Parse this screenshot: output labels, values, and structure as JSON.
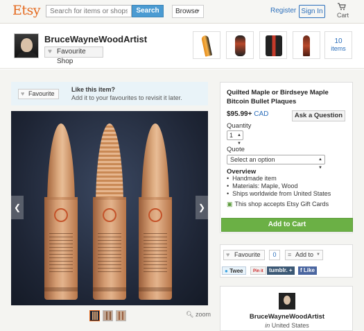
{
  "header": {
    "logo": "Etsy",
    "search_placeholder": "Search for items or shops",
    "search_button": "Search",
    "browse_label": "Browse",
    "register": "Register",
    "sign_in": "Sign In",
    "cart_label": "Cart"
  },
  "shop": {
    "name": "BruceWayneWoodArtist",
    "favourite_shop_label": "Favourite Shop",
    "items_count": "10",
    "items_label": "items"
  },
  "favourite_banner": {
    "button": "Favourite",
    "title": "Like this item?",
    "subtitle": "Add it to your favourites to revisit it later."
  },
  "gallery": {
    "zoom_label": "zoom"
  },
  "listing": {
    "title": "Quilted Maple or Birdseye Maple Bitcoin Bullet Plaques",
    "price": "$95.99+",
    "currency": "CAD",
    "ask_question": "Ask a Question",
    "quantity_label": "Quantity",
    "quantity_value": "1",
    "quote_label": "Quote",
    "quote_value": "Select an option",
    "overview_title": "Overview",
    "overview_items": [
      "Handmade item",
      "Materials: Maple, Wood",
      "Ships worldwide from United States"
    ],
    "gift_cards": "This shop accepts Etsy Gift Cards",
    "add_to_cart": "Add to Cart"
  },
  "social": {
    "favourite": "Favourite",
    "favourite_count": "0",
    "add_to": "Add to",
    "tweet": "Twee",
    "pin": "Pin it",
    "tumblr": "tumblr. +",
    "like": "Like"
  },
  "seller": {
    "name": "BruceWayneWoodArtist",
    "location_prefix": "in",
    "location": "United States"
  }
}
